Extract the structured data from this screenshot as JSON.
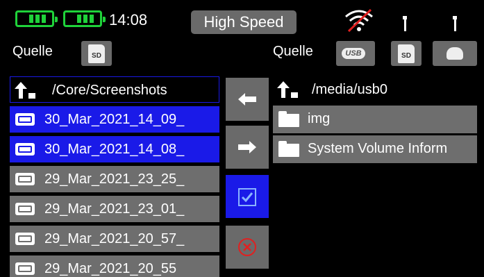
{
  "status": {
    "time": "14:08",
    "mode": "High Speed",
    "battery_left_color": "#1fd23a",
    "battery_right_color": "#1fd23a",
    "wifi_icon": "wifi-disabled-icon",
    "antenna_icons": [
      "antenna-icon",
      "antenna-icon"
    ]
  },
  "left": {
    "source_label": "Quelle",
    "source_button": "SD",
    "path": "/Core/Screenshots",
    "items": [
      {
        "label": "30_Mar_2021_14_09_",
        "selected": true
      },
      {
        "label": "30_Mar_2021_14_08_",
        "selected": true
      },
      {
        "label": "29_Mar_2021_23_25_",
        "selected": false
      },
      {
        "label": "29_Mar_2021_23_01_",
        "selected": false
      },
      {
        "label": "29_Mar_2021_20_57_",
        "selected": false
      },
      {
        "label": "29_Mar_2021_20_55",
        "selected": false
      }
    ]
  },
  "right": {
    "source_label": "Quelle",
    "source_buttons": [
      "USB",
      "SD",
      "cloud"
    ],
    "path": "/media/usb0",
    "items": [
      {
        "label": "img"
      },
      {
        "label": "System Volume Inform"
      }
    ]
  },
  "actions": {
    "copy_left": "arrow-left-icon",
    "copy_right": "arrow-right-icon",
    "select_all": "checkbox-icon",
    "delete": "cancel-circle-icon"
  }
}
